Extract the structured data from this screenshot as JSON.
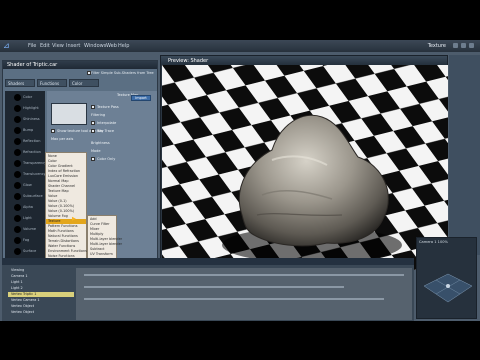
{
  "menubar": {
    "items": [
      "File",
      "Edit",
      "View",
      "Insert",
      "Windows",
      "Web",
      "Help"
    ],
    "layout_label": "Texture"
  },
  "shader_window": {
    "title": "Shader of Triptic.car",
    "global_label": "Filter Simple Sub-Shaders from Tree",
    "tabs": [
      "Shaders",
      "Functions",
      "Color"
    ],
    "node_labels": [
      "Color",
      "Highlight",
      "Shininess",
      "Bump",
      "Reflection",
      "Refraction",
      "Transparency",
      "Translucency",
      "Glow",
      "Subsurface",
      "Alpha",
      "Light",
      "Volume",
      "Fog",
      "Surface"
    ],
    "params": {
      "preview_label": "Texture Map",
      "checks": [
        "Show texture tool with tile",
        "Texture Pass",
        "Interpolate",
        "Ray Trace",
        "Max per axis"
      ],
      "labels": [
        "Filtering",
        "Brightness",
        "Mode",
        "Color Only"
      ],
      "button": "Import"
    }
  },
  "node_menu": {
    "items": [
      "None",
      "Color",
      "Color Gradient",
      "Index of Refraction",
      "LuxCore Emission",
      "Normal Map",
      "Shader Channel",
      "Texture Map",
      "Value",
      "Value (0-1)",
      "Value (0-100%)",
      "Value (0-100%)",
      "Volume Fog",
      "Texture",
      "Blend",
      "Curve Filter",
      "Mixer",
      "Pattern Functions",
      "Math Functions",
      "Natural Functions",
      "Terrain Distortions",
      "Water Functions",
      "Environment Functions",
      "Noise Functions",
      "Volume File",
      "Lux Textures",
      "LuxCore Textures",
      "LuxCore Materials",
      "LuxCore Textures",
      "LuxCore Volumes"
    ],
    "highlighted_index": 13,
    "sub_items": [
      "Add",
      "Curve Filter",
      "Mixer",
      "Multiply",
      "Multi-layer blender",
      "Multi-layer blender",
      "Subtract",
      "UV Transform"
    ]
  },
  "preview": {
    "title": "Preview: Shader"
  },
  "mini_viewport": {
    "camera_label": "Camera 1 100%"
  },
  "timeline": {
    "tracks": [
      "Viewing",
      "Camera 1",
      "Light 1",
      "Light 2",
      "Vertex Triptic 1",
      "Vertex Camera 1",
      "Vertex Object",
      "Vertex Object"
    ],
    "selected_index": 4
  },
  "colors": {
    "accent": "#e3a61c",
    "panel": "#5b6f83",
    "bg": "#4d5c6c"
  }
}
